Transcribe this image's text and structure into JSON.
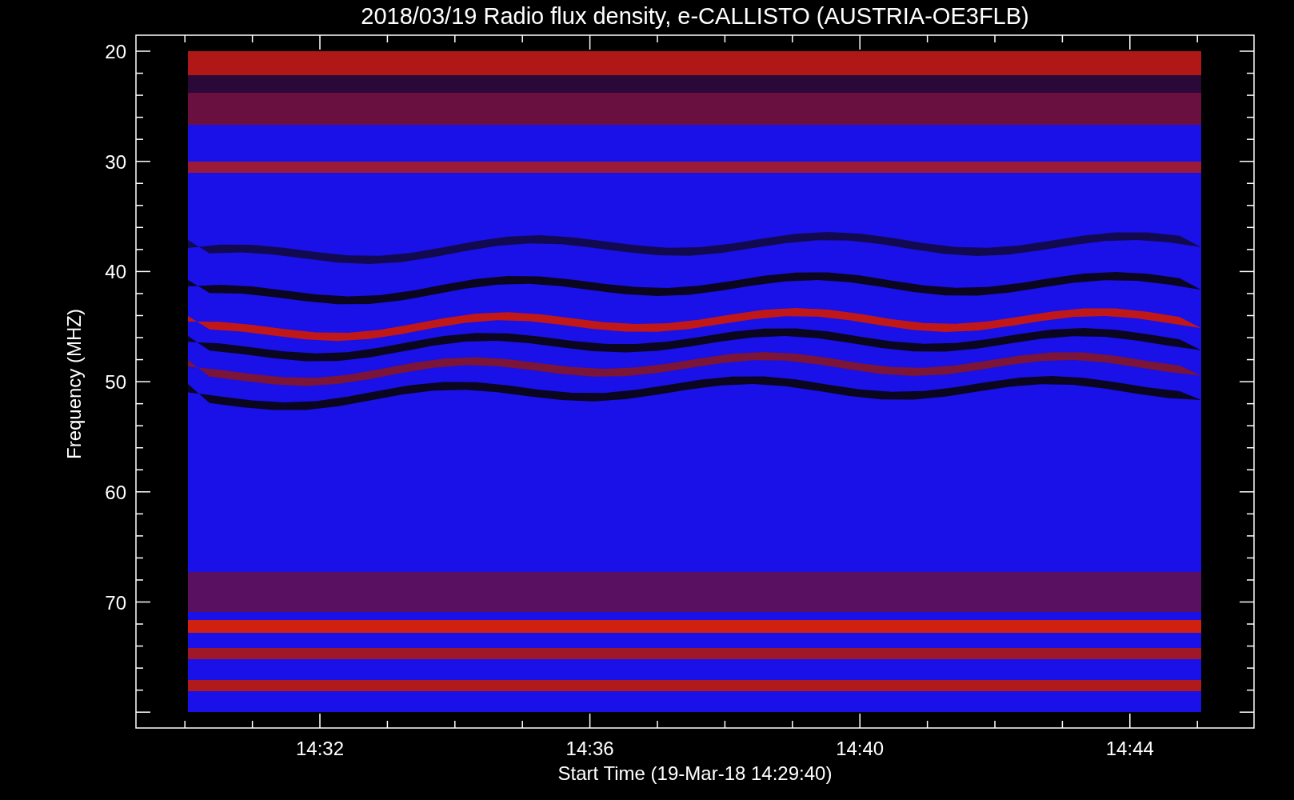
{
  "title": "2018/03/19  Radio flux density, e-CALLISTO (AUSTRIA-OE3FLB)",
  "y_axis": {
    "label": "Frequency (MHZ)",
    "ticks": [
      "20",
      "30",
      "40",
      "50",
      "60",
      "70"
    ]
  },
  "x_axis": {
    "label": "Start Time (19-Mar-18 14:29:40)",
    "ticks": [
      "14:32",
      "14:36",
      "14:40",
      "14:44"
    ]
  }
}
